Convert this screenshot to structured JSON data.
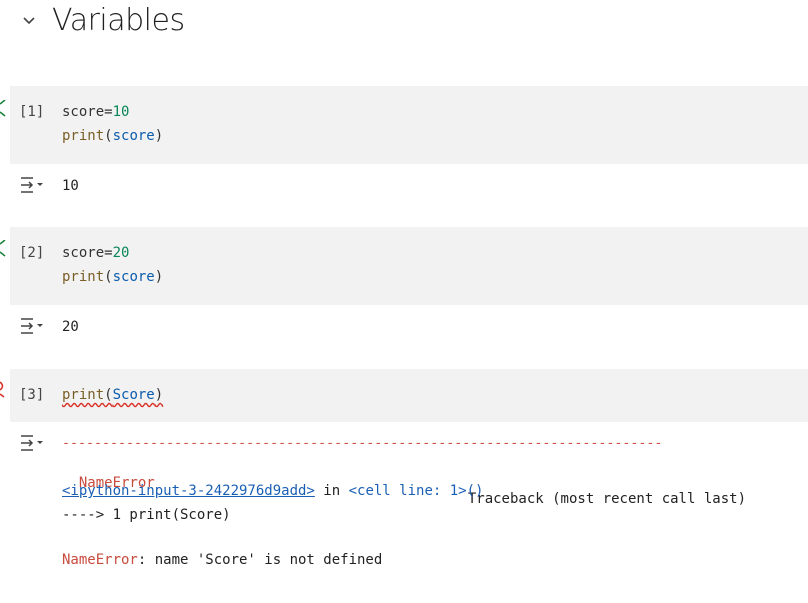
{
  "section": {
    "title": "Variables"
  },
  "cells": [
    {
      "exec": "[1]",
      "line1_name": "score",
      "line1_op": "=",
      "line1_val": "10",
      "line2_fn": "print",
      "line2_arg": "score",
      "output": "10"
    },
    {
      "exec": "[2]",
      "line1_name": "score",
      "line1_op": "=",
      "line1_val": "20",
      "line2_fn": "print",
      "line2_arg": "score",
      "output": "20"
    },
    {
      "exec": "[3]",
      "line1_fn": "print",
      "line1_arg": "Score"
    }
  ],
  "error": {
    "dashes": "---------------------------------------------------------------------------",
    "name": "NameError",
    "traceback": "Traceback (most recent call last)",
    "link": "<ipython-input-3-2422976d9add>",
    "in": " in ",
    "cell_line": "<cell line: 1>()",
    "arrow_line": "----> 1 print(Score)",
    "message_name": "NameError",
    "message": ": name 'Score' is not defined"
  },
  "icons": {
    "collapse": "chevron-down-icon",
    "output": "output-toggle-icon"
  },
  "colors": {
    "cell_bg": "#f2f2f2",
    "error": "#c84b3d",
    "link": "#1a5fb4",
    "number": "#098658"
  }
}
